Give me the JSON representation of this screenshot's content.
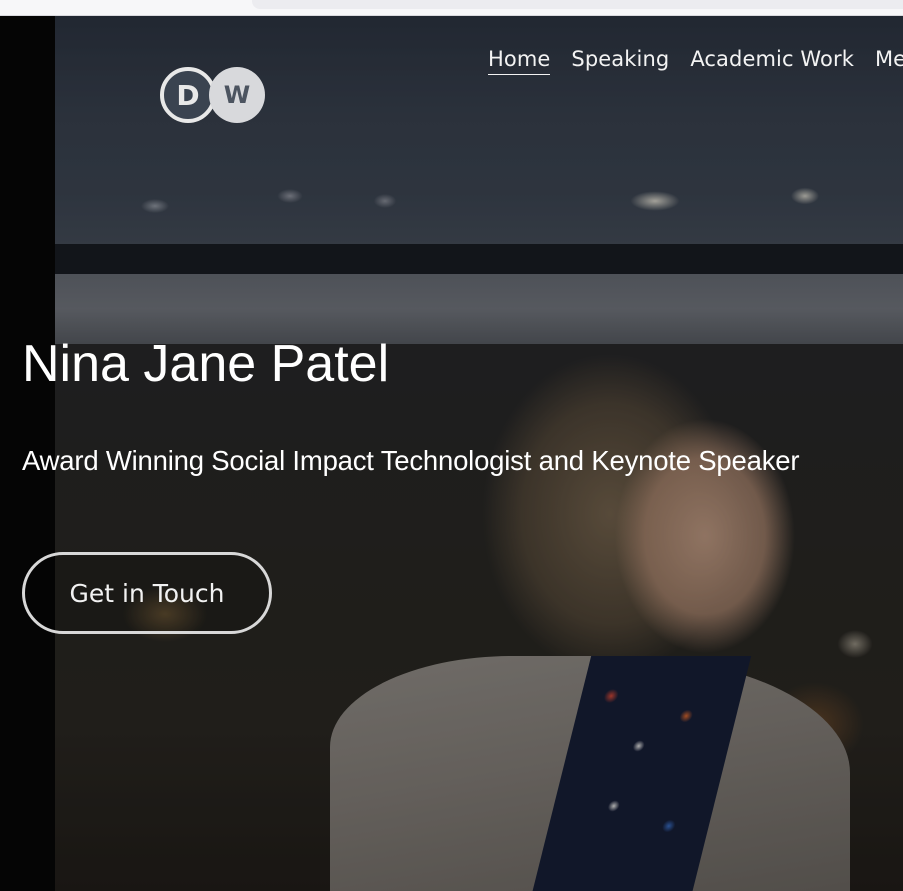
{
  "nav": {
    "items": [
      {
        "label": "Home",
        "active": true
      },
      {
        "label": "Speaking",
        "active": false
      },
      {
        "label": "Academic Work",
        "active": false
      },
      {
        "label": "Med",
        "active": false
      }
    ]
  },
  "hero": {
    "logo_text_left": "D",
    "logo_text_right": "W",
    "title": "Nina Jane Patel",
    "subtitle": "Award Winning Social Impact Technologist and Keynote Speaker",
    "cta_label": "Get in Touch"
  },
  "colors": {
    "text": "#ffffff",
    "button_border": "#d8d8d8",
    "background_left_bar": "#070707"
  }
}
